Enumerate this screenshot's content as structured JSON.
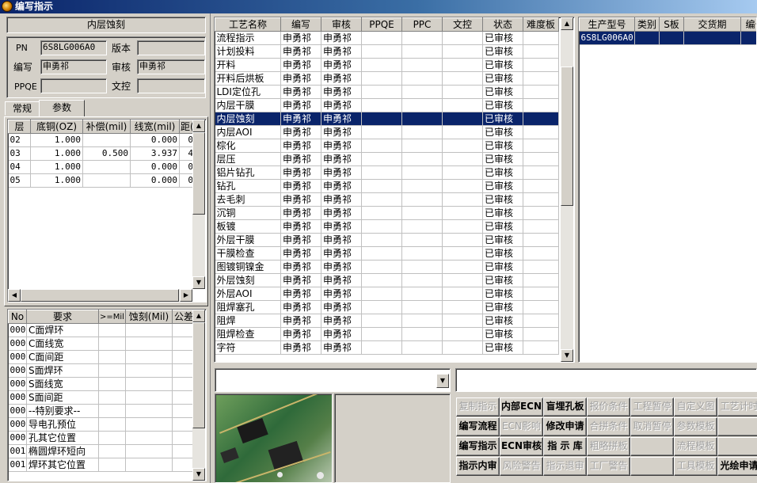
{
  "window": {
    "title": "编写指示"
  },
  "left": {
    "section_title": "内层蚀刻",
    "fields": {
      "pn_label": "PN",
      "pn_value": "6S8LG006A0",
      "version_label": "版本",
      "version_value": "",
      "writer_label": "编写",
      "writer_value": "申勇祁",
      "reviewer_label": "审核",
      "reviewer_value": "申勇祁",
      "ppqe_label": "PPQE",
      "ppqe_value": "",
      "doc_label": "文控",
      "doc_value": ""
    },
    "tabs": [
      {
        "label": "常规"
      },
      {
        "label": "参数"
      }
    ],
    "layer_table": {
      "headers": [
        "层",
        "底铜(OZ)",
        "补偿(mil)",
        "线宽(mil)",
        "距(mi"
      ],
      "rows": [
        [
          "02",
          "1.000",
          "",
          "0.000",
          "0"
        ],
        [
          "03",
          "1.000",
          "0.500",
          "3.937",
          "4"
        ],
        [
          "04",
          "1.000",
          "",
          "0.000",
          "0"
        ],
        [
          "05",
          "1.000",
          "",
          "0.000",
          "0"
        ]
      ]
    },
    "req_table": {
      "headers": [
        "No",
        "要求",
        ">=Mil",
        "蚀刻(Mil)",
        "公差"
      ],
      "rows": [
        [
          "000",
          "C面焊环"
        ],
        [
          "000",
          "C面线宽"
        ],
        [
          "000",
          "C面间距"
        ],
        [
          "000",
          "S面焊环"
        ],
        [
          "000",
          "S面线宽"
        ],
        [
          "000",
          "S面间距"
        ],
        [
          "000",
          "--特别要求--"
        ],
        [
          "000",
          "导电孔预位"
        ],
        [
          "000",
          "孔其它位置"
        ],
        [
          "001",
          "椭圆焊环短向"
        ],
        [
          "001",
          "焊环其它位置"
        ]
      ]
    }
  },
  "process_table": {
    "headers": [
      "工艺名称",
      "编写",
      "审核",
      "PPQE",
      "PPC",
      "文控",
      "状态",
      "难度板"
    ],
    "selected_index": 6,
    "rows": [
      [
        "流程指示",
        "申勇祁",
        "申勇祁",
        "已审核"
      ],
      [
        "计划投料",
        "申勇祁",
        "申勇祁",
        "已审核"
      ],
      [
        "开料",
        "申勇祁",
        "申勇祁",
        "已审核"
      ],
      [
        "开料后烘板",
        "申勇祁",
        "申勇祁",
        "已审核"
      ],
      [
        "LDI定位孔",
        "申勇祁",
        "申勇祁",
        "已审核"
      ],
      [
        "内层干膜",
        "申勇祁",
        "申勇祁",
        "已审核"
      ],
      [
        "内层蚀刻",
        "申勇祁",
        "申勇祁",
        "已审核"
      ],
      [
        "内层AOI",
        "申勇祁",
        "申勇祁",
        "已审核"
      ],
      [
        "棕化",
        "申勇祁",
        "申勇祁",
        "已审核"
      ],
      [
        "层压",
        "申勇祁",
        "申勇祁",
        "已审核"
      ],
      [
        "铝片钻孔",
        "申勇祁",
        "申勇祁",
        "已审核"
      ],
      [
        "钻孔",
        "申勇祁",
        "申勇祁",
        "已审核"
      ],
      [
        "去毛刺",
        "申勇祁",
        "申勇祁",
        "已审核"
      ],
      [
        "沉铜",
        "申勇祁",
        "申勇祁",
        "已审核"
      ],
      [
        "板镀",
        "申勇祁",
        "申勇祁",
        "已审核"
      ],
      [
        "外层干膜",
        "申勇祁",
        "申勇祁",
        "已审核"
      ],
      [
        "干膜检查",
        "申勇祁",
        "申勇祁",
        "已审核"
      ],
      [
        "图镀铜镍金",
        "申勇祁",
        "申勇祁",
        "已审核"
      ],
      [
        "外层蚀刻",
        "申勇祁",
        "申勇祁",
        "已审核"
      ],
      [
        "外层AOI",
        "申勇祁",
        "申勇祁",
        "已审核"
      ],
      [
        "阻焊塞孔",
        "申勇祁",
        "申勇祁",
        "已审核"
      ],
      [
        "阻焊",
        "申勇祁",
        "申勇祁",
        "已审核"
      ],
      [
        "阻焊检查",
        "申勇祁",
        "申勇祁",
        "已审核"
      ],
      [
        "字符",
        "申勇祁",
        "申勇祁",
        "已审核"
      ]
    ]
  },
  "model_table": {
    "headers": [
      "生产型号",
      "类别",
      "S板",
      "交货期",
      "编号"
    ],
    "rows": [
      [
        "6S8LG006A0",
        "",
        "",
        "",
        ""
      ]
    ]
  },
  "buttons": [
    [
      {
        "label": "复制指示",
        "enabled": false
      },
      {
        "label": "内部ECN",
        "enabled": true
      },
      {
        "label": "盲埋孔板",
        "enabled": true
      },
      {
        "label": "报价条件",
        "enabled": false
      },
      {
        "label": "工程暂停",
        "enabled": false
      },
      {
        "label": "自定义图",
        "enabled": false
      },
      {
        "label": "工艺计时",
        "enabled": false
      }
    ],
    [
      {
        "label": "编写流程",
        "enabled": true
      },
      {
        "label": "ECN影响",
        "enabled": false
      },
      {
        "label": "修改申请",
        "enabled": true
      },
      {
        "label": "合拼条件",
        "enabled": false
      },
      {
        "label": "取消暂停",
        "enabled": false
      },
      {
        "label": "参数模板",
        "enabled": false
      },
      {
        "label": "",
        "enabled": false
      }
    ],
    [
      {
        "label": "编写指示",
        "enabled": true
      },
      {
        "label": "ECN审核",
        "enabled": true
      },
      {
        "label": "指 示 库",
        "enabled": true
      },
      {
        "label": "粗略拼板",
        "enabled": false
      },
      {
        "label": "",
        "enabled": false
      },
      {
        "label": "流程模板",
        "enabled": false
      },
      {
        "label": "",
        "enabled": false
      }
    ],
    [
      {
        "label": "指示内审",
        "enabled": true
      },
      {
        "label": "风险警告",
        "enabled": false
      },
      {
        "label": "指示退审",
        "enabled": false
      },
      {
        "label": "工厂警告",
        "enabled": false
      },
      {
        "label": "",
        "enabled": false
      },
      {
        "label": "工具模板",
        "enabled": false
      },
      {
        "label": "光绘申请",
        "enabled": true
      }
    ]
  ]
}
